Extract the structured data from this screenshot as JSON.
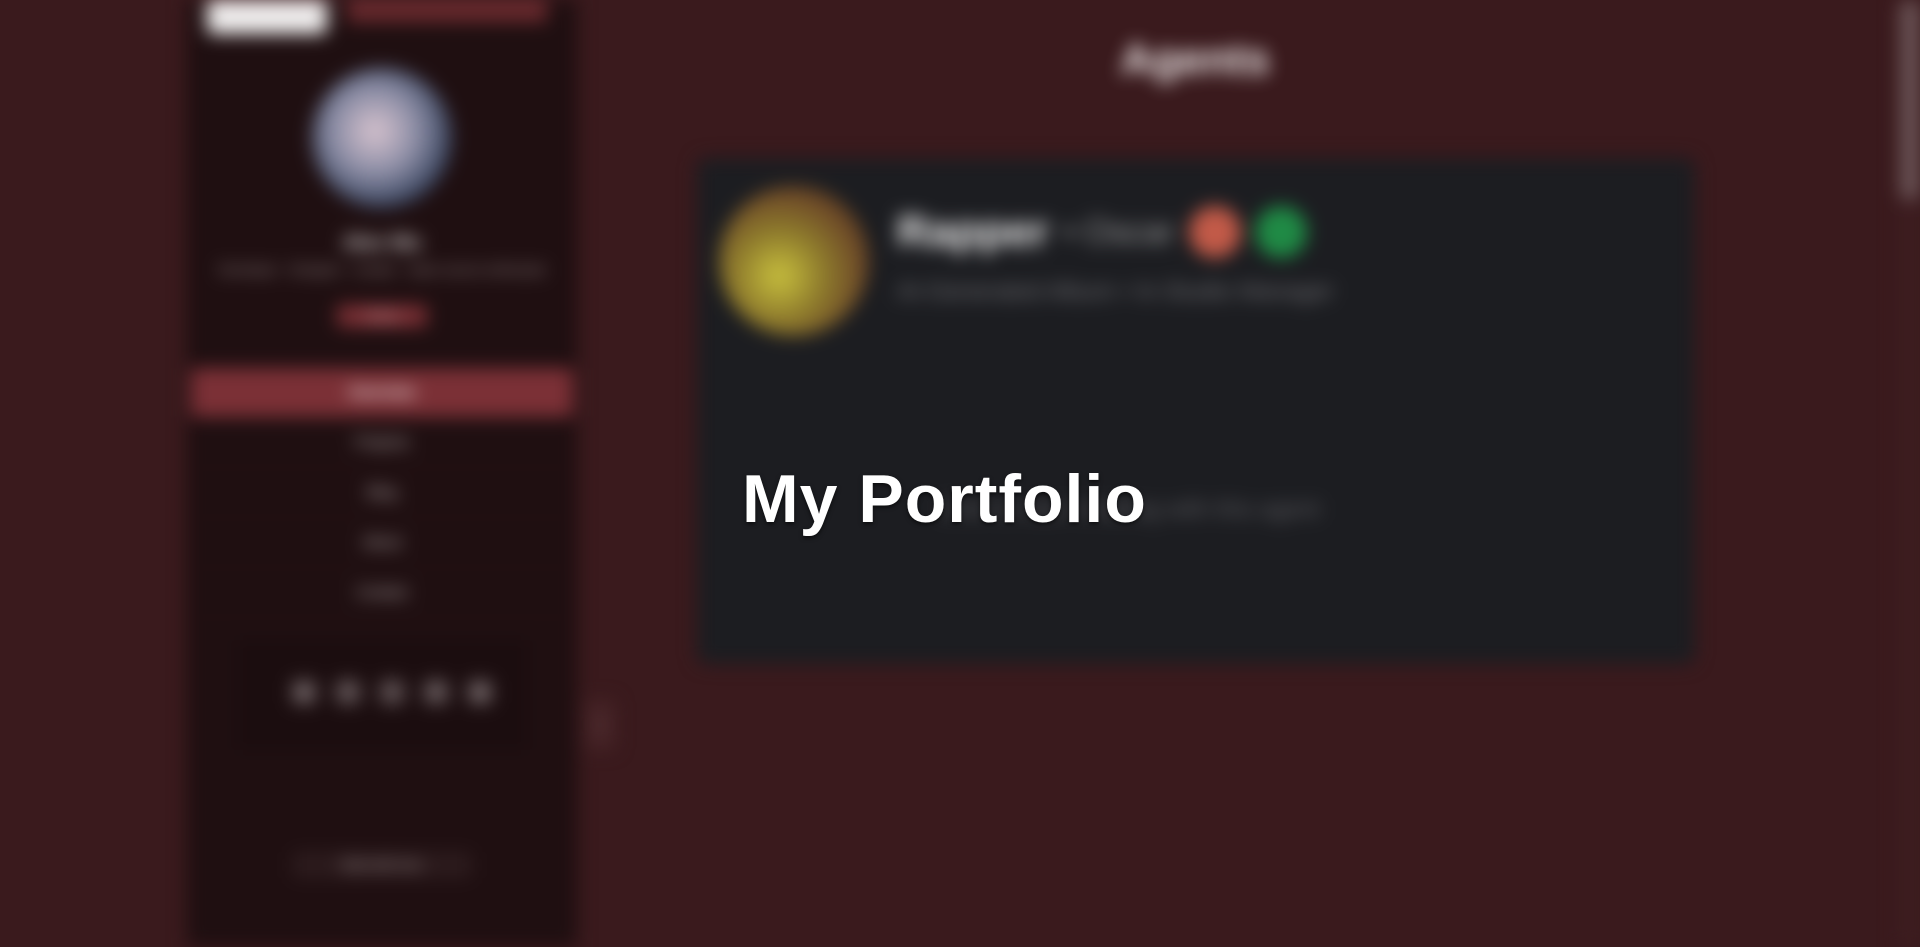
{
  "sidebar": {
    "profile": {
      "name": "Alex Wu",
      "tagline": "Developer · Designer · Creator · Open source enthusiast",
      "status": "Online"
    },
    "nav": [
      {
        "label": "Overview"
      },
      {
        "label": "Projects"
      },
      {
        "label": "Blog"
      },
      {
        "label": "About"
      },
      {
        "label": "Contact"
      }
    ],
    "social": [
      {
        "icon": "github-icon",
        "glyph": "◆"
      },
      {
        "icon": "twitter-icon",
        "glyph": "✦"
      },
      {
        "icon": "linkedin-icon",
        "glyph": "▪"
      },
      {
        "icon": "email-icon",
        "glyph": "✉"
      },
      {
        "icon": "rss-icon",
        "glyph": "◉"
      }
    ],
    "footer": "Built with love",
    "collapse_glyph": "‹"
  },
  "main": {
    "heading": "Agents",
    "card": {
      "name": "Rapper",
      "handle": "• Oscar",
      "bio": "AI-Generated Album • In-Studio Manager",
      "subtext": "Click to start chatting with this agent"
    }
  },
  "overlay": {
    "title": "My Portfolio"
  },
  "colors": {
    "background": "#3a1a1d",
    "sidebar": "#1f0f11",
    "accent": "#7b3036",
    "card": "#1c1d21"
  }
}
